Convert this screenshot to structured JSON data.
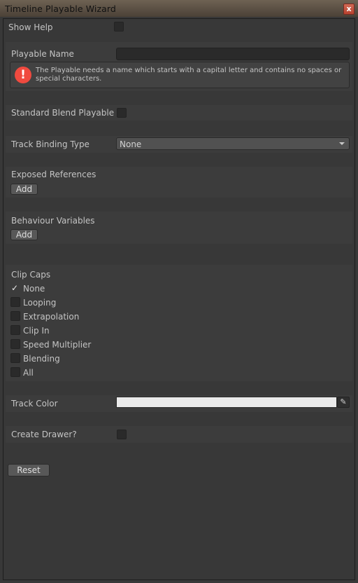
{
  "window": {
    "title": "Timeline Playable Wizard",
    "close_glyph": "x"
  },
  "show_help": {
    "label": "Show Help",
    "checked": false
  },
  "playable_name": {
    "label": "Playable Name",
    "value": "",
    "warning": "The Playable needs a name which starts with a capital letter and contains no spaces or special characters.",
    "warning_icon": "error-icon"
  },
  "standard_blend": {
    "label": "Standard Blend Playable",
    "checked": false
  },
  "track_binding": {
    "label": "Track Binding Type",
    "value": "None"
  },
  "exposed_references": {
    "label": "Exposed References",
    "add_label": "Add"
  },
  "behaviour_variables": {
    "label": "Behaviour Variables",
    "add_label": "Add"
  },
  "clip_caps": {
    "label": "Clip Caps",
    "options": [
      {
        "label": "None",
        "checked": true
      },
      {
        "label": "Looping",
        "checked": false
      },
      {
        "label": "Extrapolation",
        "checked": false
      },
      {
        "label": "Clip In",
        "checked": false
      },
      {
        "label": "Speed Multiplier",
        "checked": false
      },
      {
        "label": "Blending",
        "checked": false
      },
      {
        "label": "All",
        "checked": false
      }
    ]
  },
  "track_color": {
    "label": "Track Color",
    "value": "#eaeaea",
    "picker_icon": "eyedropper-icon"
  },
  "create_drawer": {
    "label": "Create Drawer?",
    "checked": false
  },
  "reset_label": "Reset"
}
